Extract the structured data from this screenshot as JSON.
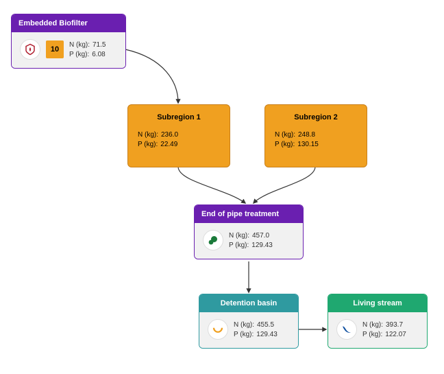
{
  "nodes": {
    "biofilter": {
      "title": "Embedded Biofilter",
      "badge": "10",
      "n_label": "N (kg):",
      "n_value": "71.5",
      "p_label": "P (kg):",
      "p_value": "6.08"
    },
    "sub1": {
      "title": "Subregion 1",
      "n_label": "N (kg):",
      "n_value": "236.0",
      "p_label": "P (kg):",
      "p_value": "22.49"
    },
    "sub2": {
      "title": "Subregion 2",
      "n_label": "N (kg):",
      "n_value": "248.8",
      "p_label": "P (kg):",
      "p_value": "130.15"
    },
    "eop": {
      "title": "End of pipe treatment",
      "n_label": "N (kg):",
      "n_value": "457.0",
      "p_label": "P (kg):",
      "p_value": "129.43"
    },
    "detention": {
      "title": "Detention basin",
      "n_label": "N (kg):",
      "n_value": "455.5",
      "p_label": "P (kg):",
      "p_value": "129.43"
    },
    "living": {
      "title": "Living stream",
      "n_label": "N (kg):",
      "n_value": "393.7",
      "p_label": "P (kg):",
      "p_value": "122.07"
    }
  }
}
